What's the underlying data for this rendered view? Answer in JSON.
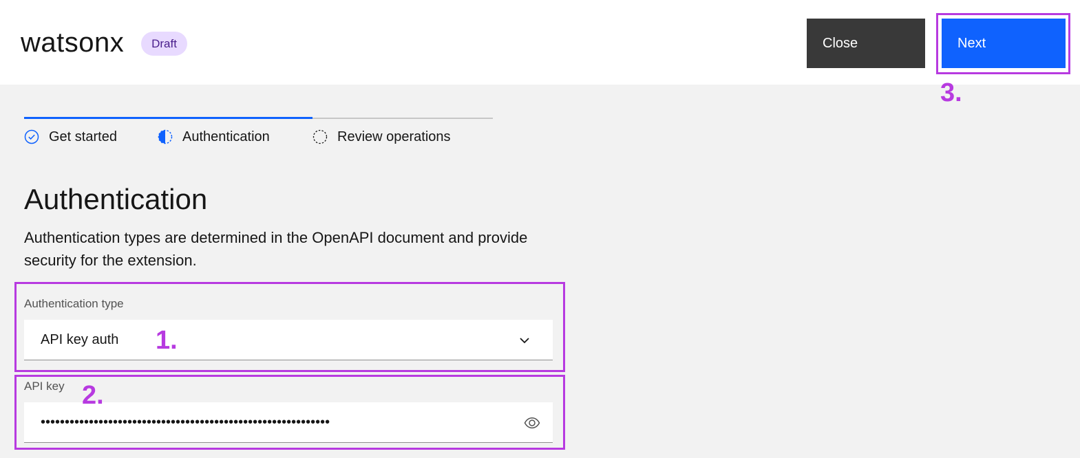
{
  "header": {
    "brand": "watsonx",
    "tag": "Draft",
    "close_label": "Close",
    "next_label": "Next"
  },
  "progress": {
    "steps": [
      {
        "label": "Get started",
        "state": "complete"
      },
      {
        "label": "Authentication",
        "state": "current"
      },
      {
        "label": "Review operations",
        "state": "incomplete"
      }
    ]
  },
  "content": {
    "title": "Authentication",
    "description": "Authentication types are determined in the OpenAPI document and provide security for the extension.",
    "auth_type": {
      "label": "Authentication type",
      "value": "API key auth"
    },
    "api_key": {
      "label": "API key",
      "value": "••••••••••••••••••••••••••••••••••••••••••••••••••••••••••••"
    }
  },
  "annotations": {
    "one": "1.",
    "two": "2.",
    "three": "3."
  },
  "colors": {
    "primary": "#0f62fe",
    "annotation": "#b73ae0",
    "tag_bg": "#e8daff"
  }
}
